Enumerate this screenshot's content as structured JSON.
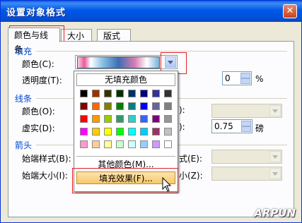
{
  "window": {
    "title": "设置对象格式",
    "close_glyph": "✕"
  },
  "tabs": [
    {
      "label": "颜色与线条",
      "active": true
    },
    {
      "label": "大小",
      "active": false
    },
    {
      "label": "版式",
      "active": false
    }
  ],
  "fill": {
    "section": "填充",
    "color_label": "颜色(C):",
    "transparency_label": "透明度(T):",
    "transparency_value": "0",
    "percent_sign": "%"
  },
  "line": {
    "section": "线条",
    "color_label": "颜色(O):",
    "dash_label": "虚实(D):",
    "weight_value": "0.75",
    "weight_unit": "磅"
  },
  "arrow": {
    "section": "箭头",
    "begin_style_label": "始端样式(B):",
    "begin_size_label": "始端大小(I):",
    "end_style_partial": "式(E):",
    "end_size_partial": "小(Z):"
  },
  "dropdown": {
    "no_fill_label": "无填充颜色",
    "more_colors_label": "其他颜色(M)...",
    "fill_effects_label": "填充效果(F)...",
    "colors": {
      "row1": [
        "#000000",
        "#993300",
        "#333300",
        "#003300",
        "#003366",
        "#000080",
        "#333399",
        "#333333"
      ],
      "row2": [
        "#800000",
        "#ff6600",
        "#808000",
        "#008000",
        "#008080",
        "#0000ff",
        "#666699",
        "#808080"
      ],
      "row3": [
        "#ff0000",
        "#ff9900",
        "#99cc00",
        "#339966",
        "#33cccc",
        "#3366ff",
        "#800080",
        "#969696"
      ],
      "row4": [
        "#ff00ff",
        "#ffcc00",
        "#ffff00",
        "#00ff00",
        "#00ffff",
        "#00ccff",
        "#993366",
        "#c0c0c0"
      ],
      "row5": [
        "#ff99cc",
        "#ffcc99",
        "#ffff99",
        "#ccffcc",
        "#ccffff",
        "#99ccff",
        "#cc99ff",
        "#ffffff"
      ]
    },
    "swatch_rows": [
      [
        "#000000",
        "#993300",
        "#333300",
        "#003300",
        "#003366",
        "#000080",
        "#333399",
        "#333333"
      ],
      [
        "#800000",
        "#ff6600",
        "#808000",
        "#008000",
        "#008080",
        "#0000ff",
        "#666699",
        "#808080"
      ],
      [
        "#ff0000",
        "#ff9900",
        "#99cc00",
        "#339966",
        "#33cccc",
        "#3366ff",
        "#800080",
        "#969696"
      ],
      [
        "#ff00ff",
        "#ffcc00",
        "#ffff00",
        "#00ff00",
        "#00ffff",
        "#00ccff",
        "#993366",
        "#c0c0c0"
      ],
      [
        "#ff99cc",
        "#ffcc99",
        "#ffff99",
        "#ccffcc",
        "#ccffff",
        "#99ccff",
        "#cc99ff",
        "#ffffff"
      ]
    ]
  },
  "watermark": "ARPUN"
}
